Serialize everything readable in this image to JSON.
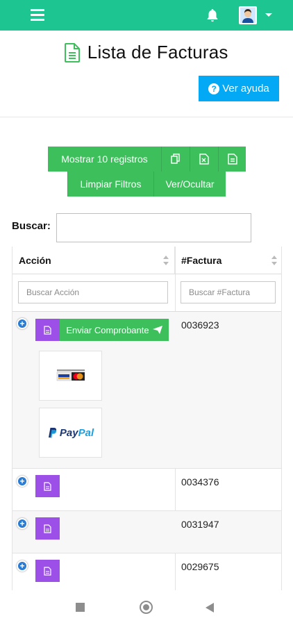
{
  "colors": {
    "topbar": "#1dc690",
    "help_button": "#03a9f4",
    "green_button": "#3dbf5c",
    "purple_button": "#9c50e8"
  },
  "header": {
    "icons": [
      "menu-icon",
      "bell-icon",
      "user-avatar",
      "chevron-down-icon"
    ]
  },
  "page": {
    "title": "Lista de Facturas",
    "help_label": "Ver ayuda"
  },
  "toolbar": {
    "show_records": "Mostrar 10 registros",
    "copy_icon": "copy-icon",
    "excel_icon": "excel-file-icon",
    "pdf_icon": "pdf-file-icon",
    "clear_filters": "Limpiar Filtros",
    "toggle_columns": "Ver/Ocultar"
  },
  "search": {
    "label": "Buscar:",
    "value": ""
  },
  "table": {
    "columns": [
      "Acción",
      "#Factura"
    ],
    "filter_placeholders": [
      "Buscar Acción",
      "Buscar #Factura"
    ],
    "send_label": "Enviar Comprobante",
    "rows": [
      {
        "invoice": "0036923",
        "expanded": true
      },
      {
        "invoice": "0034376",
        "expanded": false
      },
      {
        "invoice": "0031947",
        "expanded": false
      },
      {
        "invoice": "0029675",
        "expanded": false
      }
    ],
    "payment": {
      "paypal_part1": "Pay",
      "paypal_part2": "Pal"
    }
  }
}
